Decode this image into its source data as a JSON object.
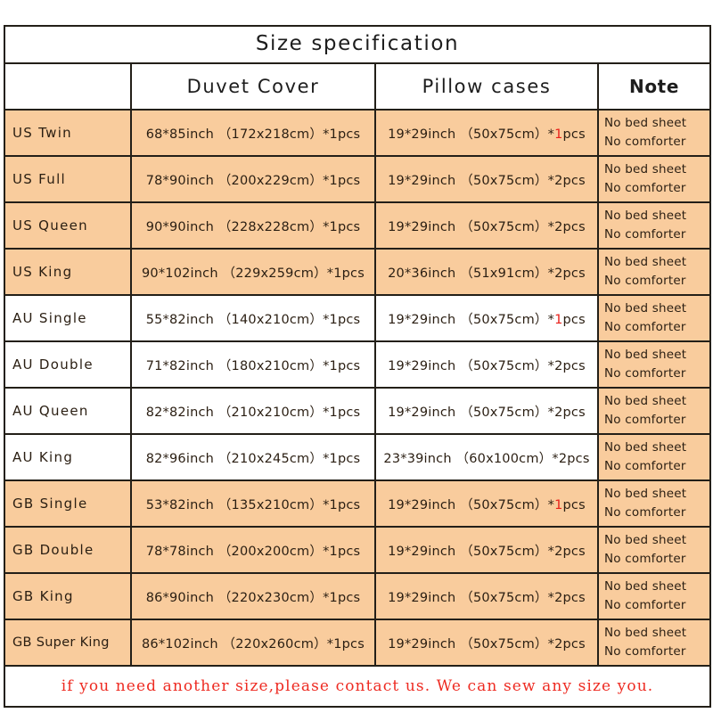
{
  "table": {
    "title": "Size specification",
    "columns": {
      "size": "",
      "duvet": "Duvet Cover",
      "pillow": "Pillow cases",
      "note": "Note"
    },
    "note_lines": {
      "line1": "No bed sheet",
      "line2": "No comforter"
    },
    "rows": [
      {
        "size": "US Twin",
        "duvet": "68*85inch （172x218cm）*1pcs",
        "pillow_pre": "19*29inch （50x75cm）*",
        "pillow_qty": "1",
        "pillow_post": "pcs",
        "pillow_qty_red": true,
        "highlight": true
      },
      {
        "size": "US Full",
        "duvet": "78*90inch （200x229cm）*1pcs",
        "pillow_pre": "19*29inch （50x75cm）*",
        "pillow_qty": "2",
        "pillow_post": "pcs",
        "pillow_qty_red": false,
        "highlight": true
      },
      {
        "size": "US Queen",
        "duvet": "90*90inch （228x228cm）*1pcs",
        "pillow_pre": "19*29inch （50x75cm）*",
        "pillow_qty": "2",
        "pillow_post": "pcs",
        "pillow_qty_red": false,
        "highlight": true
      },
      {
        "size": "US King",
        "duvet": "90*102inch （229x259cm）*1pcs",
        "pillow_pre": "20*36inch （51x91cm）*",
        "pillow_qty": "2",
        "pillow_post": "pcs",
        "pillow_qty_red": false,
        "highlight": true
      },
      {
        "size": "AU Single",
        "duvet": "55*82inch （140x210cm）*1pcs",
        "pillow_pre": "19*29inch （50x75cm）*",
        "pillow_qty": "1",
        "pillow_post": "pcs",
        "pillow_qty_red": true,
        "highlight": false
      },
      {
        "size": "AU Double",
        "duvet": "71*82inch （180x210cm）*1pcs",
        "pillow_pre": "19*29inch （50x75cm）*",
        "pillow_qty": "2",
        "pillow_post": "pcs",
        "pillow_qty_red": false,
        "highlight": false
      },
      {
        "size": "AU Queen",
        "duvet": "82*82inch （210x210cm）*1pcs",
        "pillow_pre": "19*29inch （50x75cm）*",
        "pillow_qty": "2",
        "pillow_post": "pcs",
        "pillow_qty_red": false,
        "highlight": false
      },
      {
        "size": "AU King",
        "duvet": "82*96inch （210x245cm）*1pcs",
        "pillow_pre": "23*39inch （60x100cm）*",
        "pillow_qty": "2",
        "pillow_post": "pcs",
        "pillow_qty_red": false,
        "highlight": false
      },
      {
        "size": "GB Single",
        "duvet": "53*82inch （135x210cm）*1pcs",
        "pillow_pre": "19*29inch （50x75cm）*",
        "pillow_qty": "1",
        "pillow_post": "pcs",
        "pillow_qty_red": true,
        "highlight": true
      },
      {
        "size": "GB Double",
        "duvet": "78*78inch （200x200cm）*1pcs",
        "pillow_pre": "19*29inch （50x75cm）*",
        "pillow_qty": "2",
        "pillow_post": "pcs",
        "pillow_qty_red": false,
        "highlight": true
      },
      {
        "size": "GB King",
        "duvet": "86*90inch （220x230cm）*1pcs",
        "pillow_pre": "19*29inch （50x75cm）*",
        "pillow_qty": "2",
        "pillow_post": "pcs",
        "pillow_qty_red": false,
        "highlight": true
      },
      {
        "size": "GB Super King",
        "duvet": "86*102inch （220x260cm）*1pcs",
        "pillow_pre": "19*29inch （50x75cm）*",
        "pillow_qty": "2",
        "pillow_post": "pcs",
        "pillow_qty_red": false,
        "highlight": true
      }
    ],
    "footer": "if you need another size,please contact us. We can sew any size you."
  },
  "colors": {
    "highlight_row": "#f9cc9d",
    "note_column": "#f9cc9d",
    "border": "#231f18",
    "footer_text": "#ee2b22",
    "accent_red": "#e8201a"
  }
}
